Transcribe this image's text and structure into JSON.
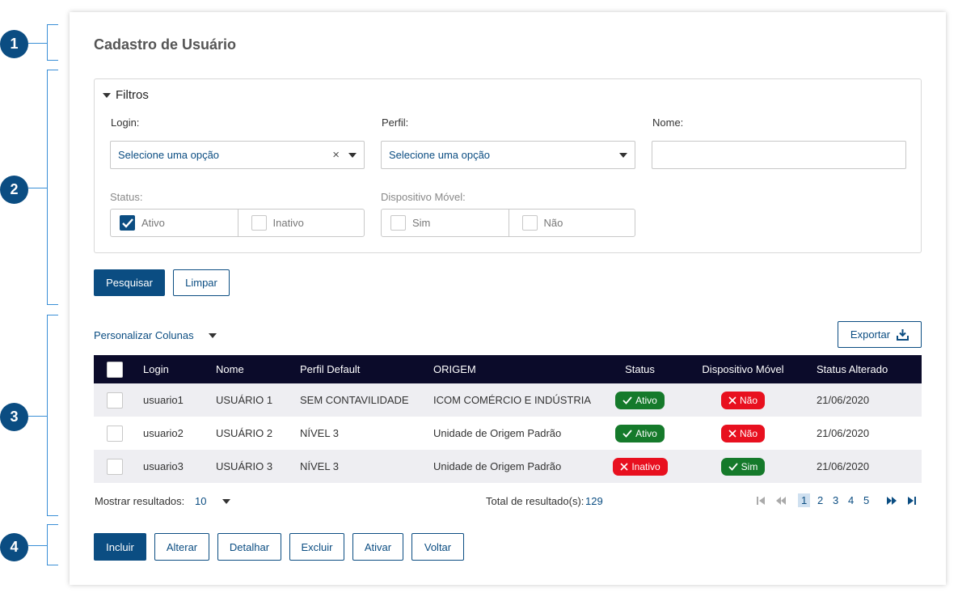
{
  "annotations": [
    "1",
    "2",
    "3",
    "4"
  ],
  "page": {
    "title": "Cadastro de Usuário"
  },
  "filters": {
    "toggle_label": "Filtros",
    "login": {
      "label": "Login:",
      "value": "Selecione uma opção"
    },
    "perfil": {
      "label": "Perfil:",
      "value": "Selecione uma opção"
    },
    "nome": {
      "label": "Nome:",
      "value": ""
    },
    "status": {
      "label": "Status:",
      "options": [
        {
          "label": "Ativo",
          "checked": true
        },
        {
          "label": "Inativo",
          "checked": false
        }
      ]
    },
    "dispositivo": {
      "label": "Dispositivo Móvel:",
      "options": [
        {
          "label": "Sim",
          "checked": false
        },
        {
          "label": "Não",
          "checked": false
        }
      ]
    }
  },
  "actions": {
    "search": "Pesquisar",
    "clear": "Limpar"
  },
  "toolbar": {
    "customize": "Personalizar Colunas",
    "export": "Exportar"
  },
  "table": {
    "columns": [
      "Login",
      "Nome",
      "Perfil Default",
      "ORIGEM",
      "Status",
      "Dispositivo Móvel",
      "Status Alterado"
    ],
    "rows": [
      {
        "login": "usuario1",
        "nome": "USUÁRIO 1",
        "perfil": "SEM CONTAVILIDADE",
        "origem": "ICOM COMÉRCIO E INDÚSTRIA",
        "status": "Ativo",
        "dispositivo": "Não",
        "alterado": "21/06/2020"
      },
      {
        "login": "usuario2",
        "nome": "USUÁRIO 2",
        "perfil": "NÍVEL 3",
        "origem": "Unidade de Origem Padrão",
        "status": "Ativo",
        "dispositivo": "Não",
        "alterado": "21/06/2020"
      },
      {
        "login": "usuario3",
        "nome": "USUÁRIO 3",
        "perfil": "NÍVEL 3",
        "origem": "Unidade de Origem Padrão",
        "status": "Inativo",
        "dispositivo": "Sim",
        "alterado": "21/06/2020"
      }
    ]
  },
  "footer": {
    "show_label": "Mostrar resultados:",
    "show_value": "10",
    "total_label": "Total de resultado(s):",
    "total_value": "129",
    "pages": [
      "1",
      "2",
      "3",
      "4",
      "5"
    ],
    "current_page": "1"
  },
  "bottom_actions": [
    "Incluir",
    "Alterar",
    "Detalhar",
    "Excluir",
    "Ativar",
    "Voltar"
  ],
  "colors": {
    "primary": "#0b4d82",
    "header": "#0b0b2a",
    "success": "#157a2b",
    "danger": "#e8101f"
  }
}
